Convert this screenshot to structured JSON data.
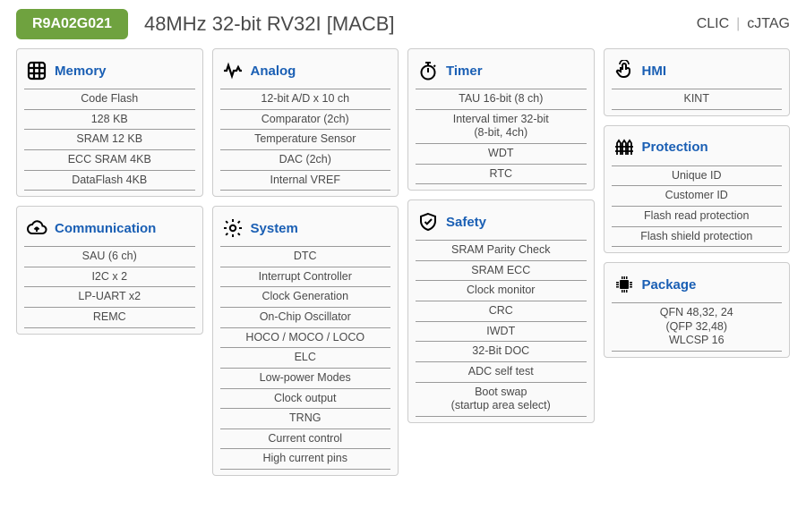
{
  "header": {
    "chip_badge": "R9A02G021",
    "title": "48MHz 32-bit RV32I [MACB]",
    "right1": "CLIC",
    "right2": "cJTAG"
  },
  "cards": {
    "memory": {
      "title": "Memory",
      "items": [
        "Code Flash",
        "128 KB",
        "SRAM 12 KB",
        "ECC SRAM 4KB",
        "DataFlash 4KB"
      ]
    },
    "analog": {
      "title": "Analog",
      "items": [
        "12-bit A/D x 10 ch",
        "Comparator (2ch)",
        "Temperature Sensor",
        "DAC (2ch)",
        "Internal VREF"
      ]
    },
    "timer": {
      "title": "Timer",
      "items": [
        "TAU 16-bit (8 ch)",
        "Interval timer 32-bit\n(8-bit, 4ch)",
        "WDT",
        "RTC"
      ]
    },
    "hmi": {
      "title": "HMI",
      "items": [
        "KINT"
      ]
    },
    "communication": {
      "title": "Communication",
      "items": [
        "SAU (6 ch)",
        "I2C x 2",
        "LP-UART x2",
        "REMC"
      ]
    },
    "system": {
      "title": "System",
      "items": [
        "DTC",
        "Interrupt Controller",
        "Clock Generation",
        "On-Chip Oscillator",
        "HOCO / MOCO / LOCO",
        "ELC",
        "Low-power Modes",
        "Clock output",
        "TRNG",
        "Current control",
        "High current pins"
      ]
    },
    "safety": {
      "title": "Safety",
      "items": [
        "SRAM Parity Check",
        "SRAM ECC",
        "Clock monitor",
        "CRC",
        "IWDT",
        "32-Bit DOC",
        "ADC self test",
        "Boot swap\n(startup area select)"
      ]
    },
    "protection": {
      "title": "Protection",
      "items": [
        "Unique ID",
        "Customer ID",
        "Flash read protection",
        "Flash shield protection"
      ]
    },
    "package": {
      "title": "Package",
      "items": [
        "QFN 48,32, 24\n(QFP 32,48)\nWLCSP 16"
      ]
    }
  }
}
